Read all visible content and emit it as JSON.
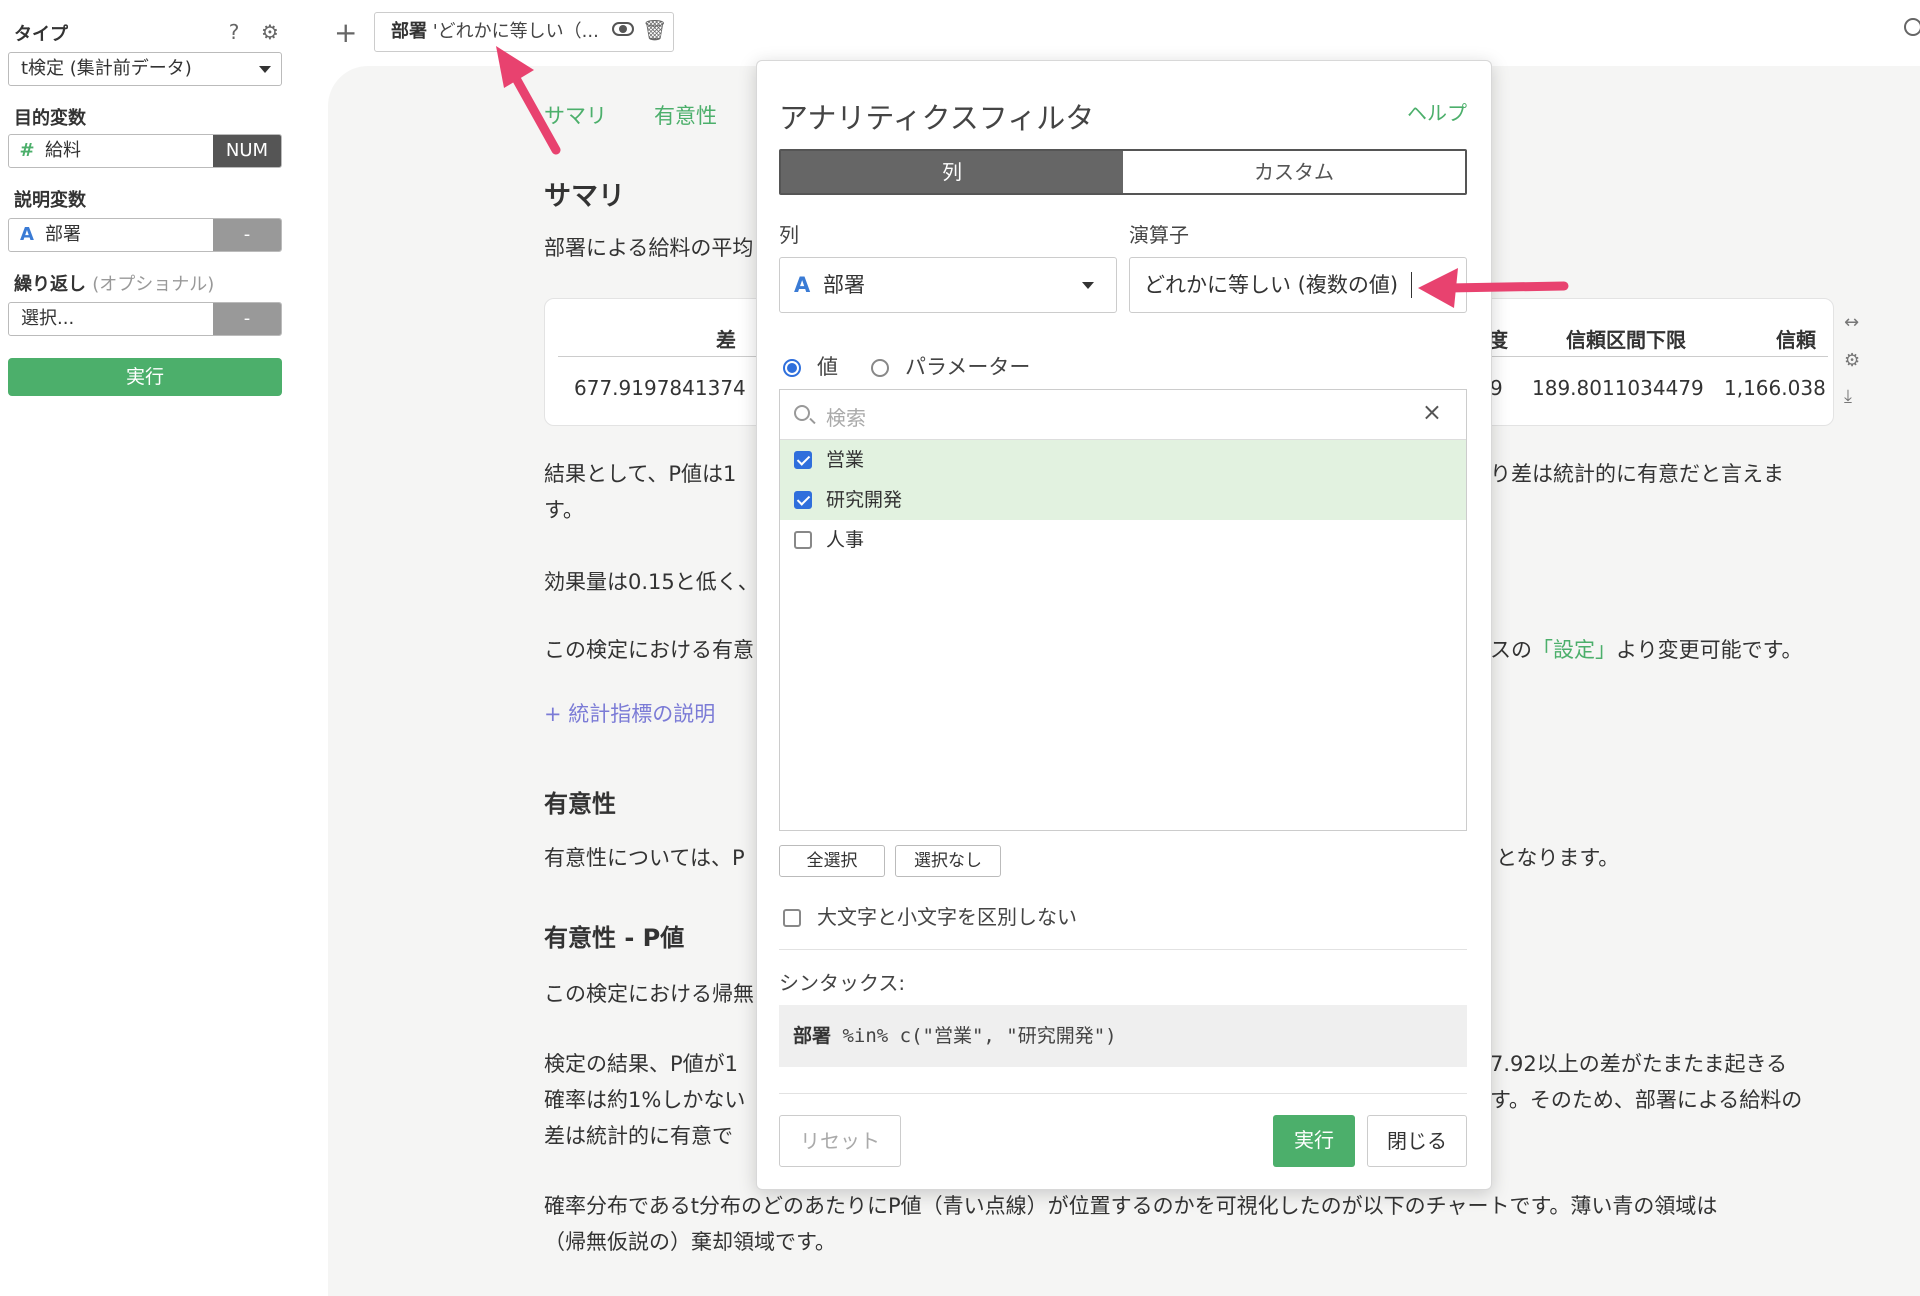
{
  "sidebar": {
    "type_label": "タイプ",
    "type_value": "t検定 (集計前データ)",
    "target_label": "目的変数",
    "target_icon": "#",
    "target_value": "給料",
    "target_tag": "NUM",
    "explain_label": "説明変数",
    "explain_icon": "A",
    "explain_value": "部署",
    "explain_tag": "-",
    "repeat_label": "繰り返し",
    "repeat_optional": "(オプショナル)",
    "repeat_value": "選択...",
    "repeat_tag": "-",
    "run_button": "実行"
  },
  "toolbar": {
    "plus": "+",
    "filter_column": "部署",
    "filter_rest": " 'どれかに等しい（..."
  },
  "report": {
    "tabs": [
      "サマリ",
      "有意性"
    ],
    "summary_heading": "サマリ",
    "summary_text": "部署による給料の平均",
    "table_headers": {
      "diff": "差",
      "ci_lower": "信頼区間下限",
      "ci": "信頼",
      "partial": "度"
    },
    "table_values": {
      "diff": "677.9197841374",
      "partial": "9",
      "ci_lower": "189.8011034479",
      "ci": "1,166.038"
    },
    "result_line1_left": "結果として、P値は1",
    "result_line1_right": "り差は統計的に有意だと言えま",
    "result_line2": "す。",
    "effect_line": "効果量は0.15と低く、",
    "sig_level_left": "この検定における有意",
    "sig_level_right_a": "スの",
    "sig_level_link": "「設定」",
    "sig_level_right_b": "より変更可能です。",
    "stats_link": "+ 統計指標の説明",
    "sig_heading": "有意性",
    "sig_text_left": "有意性については、P",
    "sig_text_right": "となります。",
    "pval_heading": "有意性 - P値",
    "pval_text": "この検定における帰無",
    "result2_line1_left": "検定の結果、P値が1",
    "result2_line1_right": "7.92以上の差がたまたま起きる",
    "result2_line2_left": "確率は約1%しかない",
    "result2_line2_right": "す。そのため、部署による給料の",
    "result2_line3_left": "差は統計的に有意で",
    "dist_line1": "確率分布であるt分布のどのあたりにP値（青い点線）が位置するのかを可視化したのが以下のチャートです。薄い青の領域は",
    "dist_line2": "（帰無仮説の）棄却領域です。"
  },
  "modal": {
    "title": "アナリティクスフィルタ",
    "help": "ヘルプ",
    "seg_column": "列",
    "seg_custom": "カスタム",
    "column_label": "列",
    "operator_label": "演算子",
    "column_icon": "A",
    "column_value": "部署",
    "operator_value": "どれかに等しい (複数の値)",
    "radio_value": "値",
    "radio_param": "パラメーター",
    "search_placeholder": "検索",
    "items": [
      {
        "label": "営業",
        "checked": true
      },
      {
        "label": "研究開発",
        "checked": true
      },
      {
        "label": "人事",
        "checked": false
      }
    ],
    "select_all": "全選択",
    "select_none": "選択なし",
    "ignore_case": "大文字と小文字を区別しない",
    "syntax_label": "シンタックス:",
    "syntax_column": "部署",
    "syntax_rest": " %in% c(\"営業\", \"研究開発\")",
    "reset": "リセット",
    "run": "実行",
    "close": "閉じる"
  },
  "colors": {
    "accent_green": "#4caf6b",
    "arrow_pink": "#e8426f",
    "checkbox_blue": "#2f6fdc"
  }
}
